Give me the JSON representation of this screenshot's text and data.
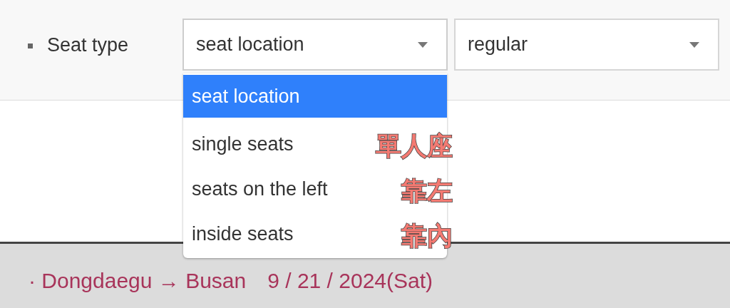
{
  "seat_type": {
    "label": "Seat type",
    "location_select": {
      "value": "seat location",
      "expanded": true
    },
    "class_select": {
      "value": "regular"
    }
  },
  "location_options": [
    {
      "label": "seat location",
      "selected": true
    },
    {
      "label": "single seats",
      "selected": false,
      "note": "單人座"
    },
    {
      "label": "seats on the left",
      "selected": false,
      "note": "靠左"
    },
    {
      "label": "inside seats",
      "selected": false,
      "note": "靠內"
    }
  ],
  "route": {
    "text": "· Dongdaegu → Busan",
    "date": "9 / 21 / 2024(Sat)"
  }
}
